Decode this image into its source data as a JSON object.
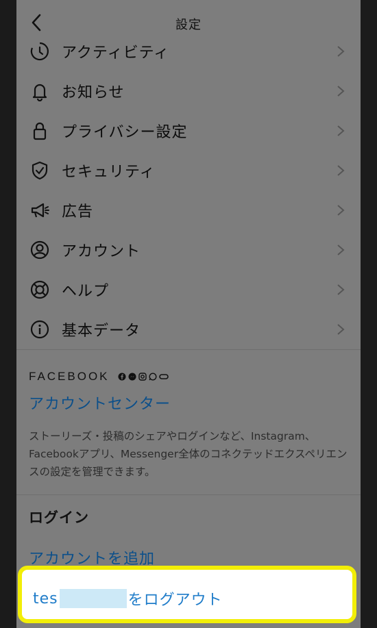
{
  "header": {
    "title": "設定"
  },
  "menu": [
    {
      "label": "アクティビティ",
      "icon": "activity-icon"
    },
    {
      "label": "お知らせ",
      "icon": "bell-icon"
    },
    {
      "label": "プライバシー設定",
      "icon": "lock-icon"
    },
    {
      "label": "セキュリティ",
      "icon": "shield-icon"
    },
    {
      "label": "広告",
      "icon": "megaphone-icon"
    },
    {
      "label": "アカウント",
      "icon": "account-icon"
    },
    {
      "label": "ヘルプ",
      "icon": "lifebuoy-icon"
    },
    {
      "label": "基本データ",
      "icon": "info-icon"
    }
  ],
  "facebook": {
    "brand": "FACEBOOK",
    "account_center": "アカウントセンター",
    "description": "ストーリーズ・投稿のシェアやログインなど、Instagram、Facebookアプリ、Messenger全体のコネクテッドエクスペリエンスの設定を管理できます。"
  },
  "login": {
    "title": "ログイン",
    "add_account": "アカウントを追加",
    "logout_prefix": "tes",
    "logout_suffix": "をログアウト"
  },
  "colors": {
    "highlight": "#f2ee07",
    "link": "#0b4f8a",
    "logout_link": "#1f7cc9"
  }
}
